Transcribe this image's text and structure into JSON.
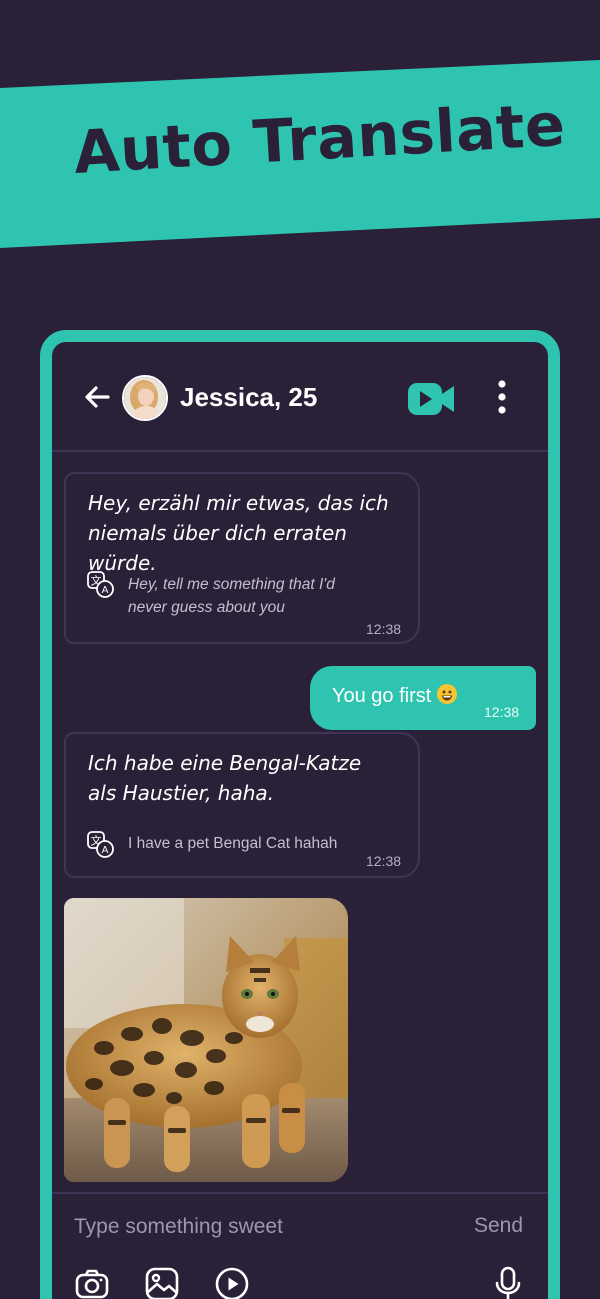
{
  "banner": {
    "title": "Auto Translate",
    "band_color": "#2ec4b0"
  },
  "chat_header": {
    "contact_name": "Jessica, 25",
    "back_icon": "arrow-left-icon",
    "video_icon": "video-camera-icon",
    "menu_icon": "more-vertical-icon"
  },
  "messages": [
    {
      "direction": "incoming",
      "original": [
        "Hey, erzähl mir etwas, das ich",
        "niemals über dich erraten würde."
      ],
      "translation": [
        "Hey, tell me something that I'd",
        "never guess about you"
      ],
      "time": "12:38"
    },
    {
      "direction": "outgoing",
      "text": "You go first",
      "emoji": "grinning-face-emoji",
      "time": "12:38"
    },
    {
      "direction": "incoming",
      "original": [
        "Ich habe eine Bengal-Katze",
        "als Haustier, haha."
      ],
      "translation": [
        "I have a pet Bengal Cat hahah"
      ],
      "time": "12:38"
    },
    {
      "direction": "incoming",
      "type": "image",
      "image": "bengal-cat-photo"
    }
  ],
  "composer": {
    "placeholder": "Type something sweet",
    "send_label": "Send",
    "tools": [
      "camera-icon",
      "gallery-icon",
      "play-icon",
      "microphone-icon"
    ]
  },
  "colors": {
    "background": "#2a2139",
    "accent": "#2ec4b0",
    "bubble_border": "#3e3456"
  }
}
